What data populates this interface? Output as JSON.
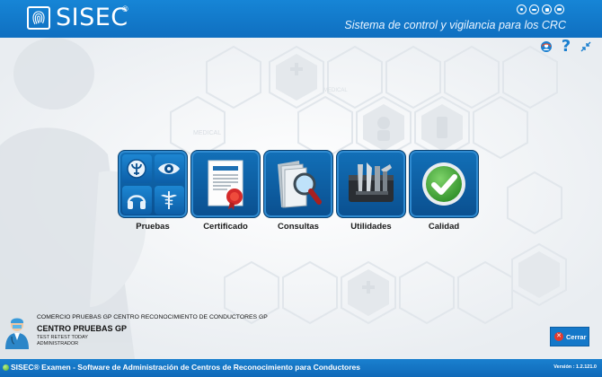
{
  "header": {
    "app_name": "SISEC",
    "registered_mark": "®",
    "tagline": "Sistema de control y vigilancia para los CRC",
    "header_icons": [
      "compact-disc-icon",
      "stethoscope-icon",
      "lock-icon",
      "monitor-icon"
    ]
  },
  "tools": {
    "icons": [
      "support-icon",
      "help-icon",
      "collapse-icon"
    ],
    "help_glyph": "?"
  },
  "tiles": [
    {
      "label": "Pruebas",
      "icon": "tests-grid-icon"
    },
    {
      "label": "Certificado",
      "icon": "certificate-icon"
    },
    {
      "label": "Consultas",
      "icon": "search-folder-icon"
    },
    {
      "label": "Utilidades",
      "icon": "tools-icon"
    },
    {
      "label": "Calidad",
      "icon": "check-circle-icon"
    }
  ],
  "user": {
    "company": "COMERCIO PRUEBAS GP CENTRO RECONOCIMIENTO DE CONDUCTORES GP",
    "center": "CENTRO PRUEBAS GP",
    "username": "TEST RETEST TODAY",
    "role": "ADMINISTRADOR"
  },
  "close_button": {
    "label": "Cerrar",
    "glyph": "✕"
  },
  "statusbar": {
    "text": "SISEC® Examen - Software de Administración de Centros de Reconocimiento para Conductores",
    "version": "Versión : 1.2.121.0"
  },
  "colors": {
    "brand_blue": "#1478c9",
    "tile_blue": "#0a4f8f",
    "close_red": "#e33a2d",
    "check_green": "#3fa335"
  }
}
